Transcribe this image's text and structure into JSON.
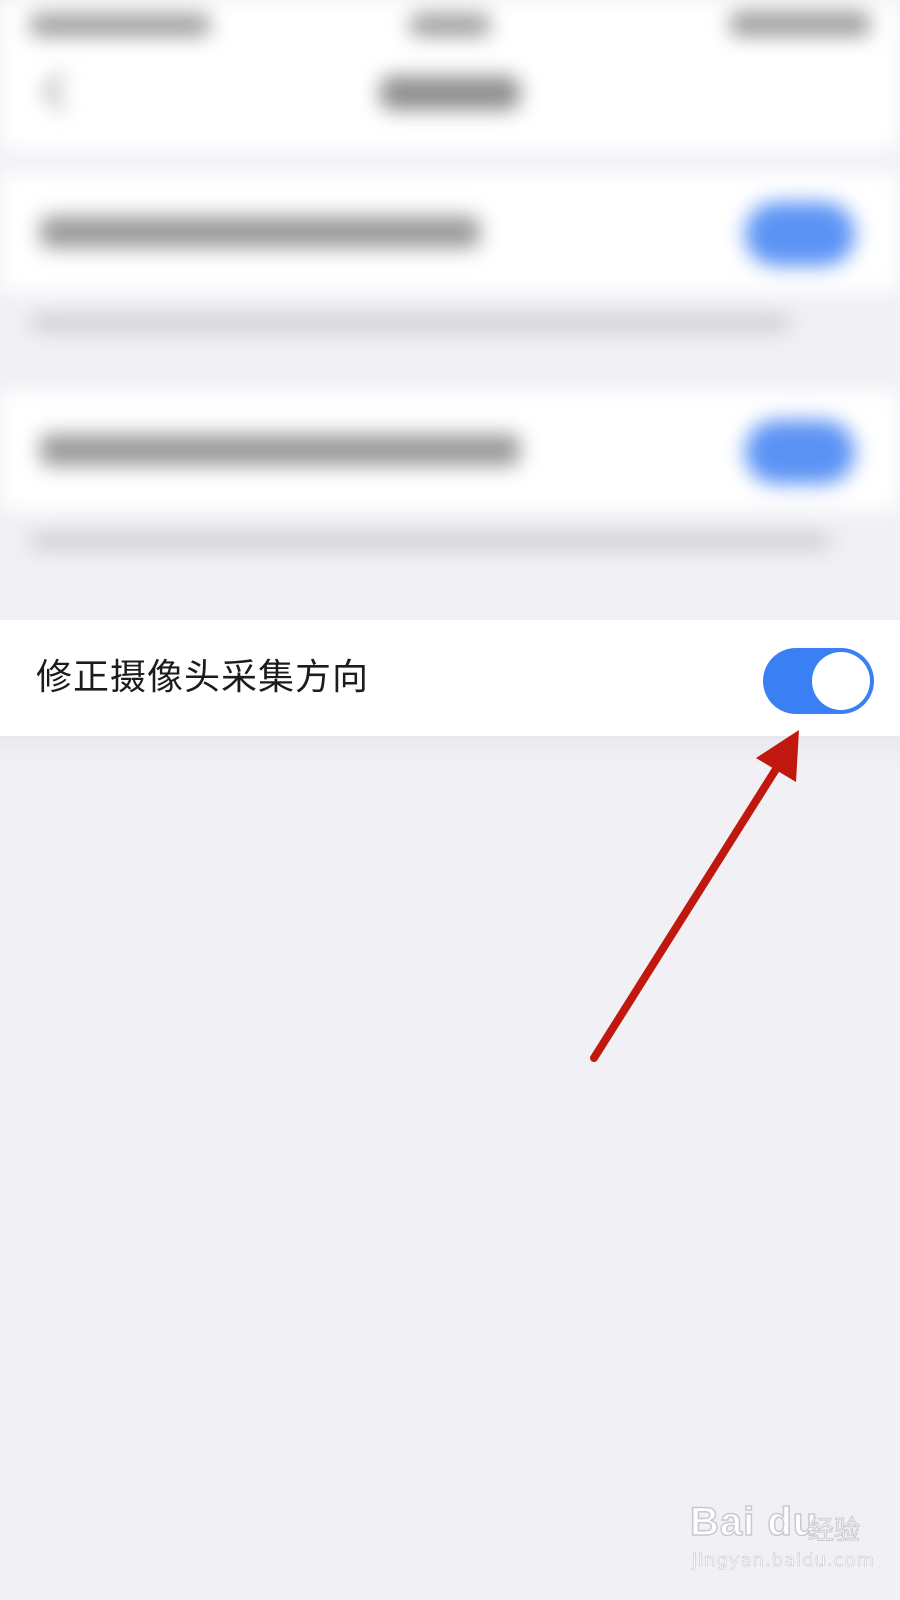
{
  "setting": {
    "label": "修正摄像头采集方向",
    "enabled": true
  },
  "colors": {
    "background": "#F1F0F5",
    "row": "#FFFFFF",
    "toggle_on": "#3B7FF5",
    "annotation_arrow": "#C0180F"
  },
  "watermark": {
    "brand": "Bai du",
    "suffix": "经验",
    "url": "jingyan.baidu.com"
  }
}
